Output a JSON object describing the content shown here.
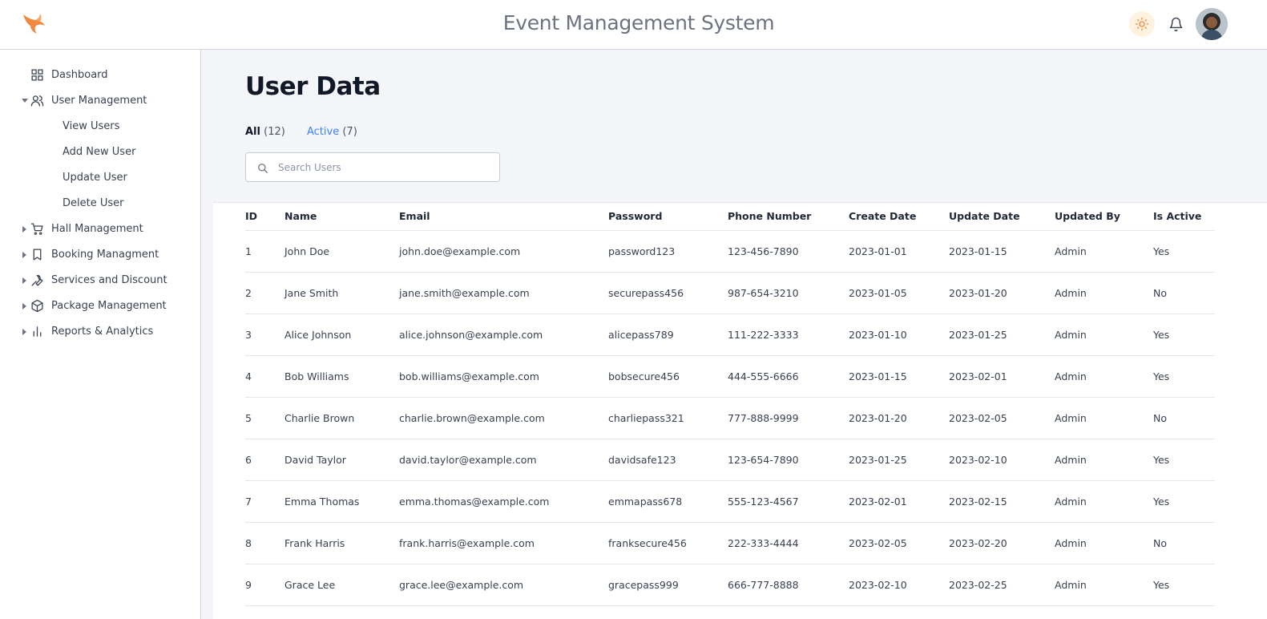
{
  "header": {
    "title": "Event Management System",
    "logo_icon": "fox-logo-icon",
    "brand_color": "#f0883e"
  },
  "sidebar": {
    "items": [
      {
        "label": "Dashboard",
        "icon": "grid-icon"
      },
      {
        "label": "User Management",
        "icon": "users-icon",
        "expanded": true,
        "children": [
          "View Users",
          "Add New User",
          "Update User",
          "Delete User"
        ]
      },
      {
        "label": "Hall Management",
        "icon": "cart-icon"
      },
      {
        "label": "Booking Managment",
        "icon": "bookmark-icon"
      },
      {
        "label": "Services and Discount",
        "icon": "wrench-icon"
      },
      {
        "label": "Package Management",
        "icon": "box-icon"
      },
      {
        "label": "Reports & Analytics",
        "icon": "bar-chart-icon"
      }
    ]
  },
  "main": {
    "page_title": "User Data",
    "tabs": [
      {
        "label": "All",
        "count": "(12)"
      },
      {
        "label": "Active",
        "count": "(7)"
      }
    ],
    "search": {
      "placeholder": "Search Users",
      "value": ""
    },
    "accent_color": "#3b82f6",
    "table": {
      "columns": [
        "ID",
        "Name",
        "Email",
        "Password",
        "Phone Number",
        "Create Date",
        "Update Date",
        "Updated By",
        "Is Active"
      ],
      "rows": [
        [
          "1",
          "John Doe",
          "john.doe@example.com",
          "password123",
          "123-456-7890",
          "2023-01-01",
          "2023-01-15",
          "Admin",
          "Yes"
        ],
        [
          "2",
          "Jane Smith",
          "jane.smith@example.com",
          "securepass456",
          "987-654-3210",
          "2023-01-05",
          "2023-01-20",
          "Admin",
          "No"
        ],
        [
          "3",
          "Alice Johnson",
          "alice.johnson@example.com",
          "alicepass789",
          "111-222-3333",
          "2023-01-10",
          "2023-01-25",
          "Admin",
          "Yes"
        ],
        [
          "4",
          "Bob Williams",
          "bob.williams@example.com",
          "bobsecure456",
          "444-555-6666",
          "2023-01-15",
          "2023-02-01",
          "Admin",
          "Yes"
        ],
        [
          "5",
          "Charlie Brown",
          "charlie.brown@example.com",
          "charliepass321",
          "777-888-9999",
          "2023-01-20",
          "2023-02-05",
          "Admin",
          "No"
        ],
        [
          "6",
          "David Taylor",
          "david.taylor@example.com",
          "davidsafe123",
          "123-654-7890",
          "2023-01-25",
          "2023-02-10",
          "Admin",
          "Yes"
        ],
        [
          "7",
          "Emma Thomas",
          "emma.thomas@example.com",
          "emmapass678",
          "555-123-4567",
          "2023-02-01",
          "2023-02-15",
          "Admin",
          "Yes"
        ],
        [
          "8",
          "Frank Harris",
          "frank.harris@example.com",
          "franksecure456",
          "222-333-4444",
          "2023-02-05",
          "2023-02-20",
          "Admin",
          "No"
        ],
        [
          "9",
          "Grace Lee",
          "grace.lee@example.com",
          "gracepass999",
          "666-777-8888",
          "2023-02-10",
          "2023-02-25",
          "Admin",
          "Yes"
        ]
      ]
    }
  }
}
